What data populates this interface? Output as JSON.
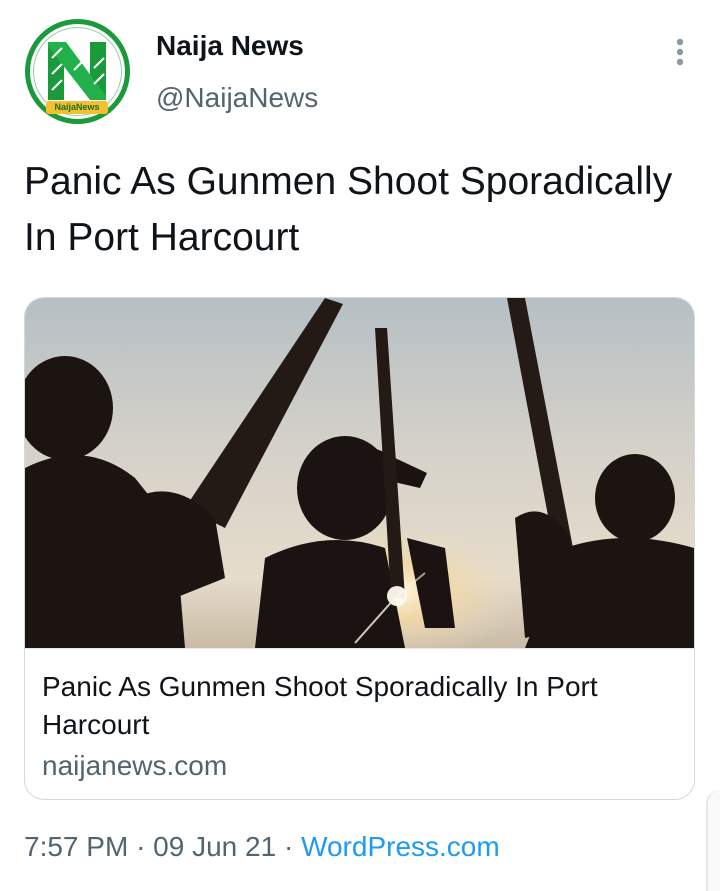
{
  "author": {
    "display_name": "Naija News",
    "handle": "@NaijaNews",
    "avatar_badge": "NaijaNews",
    "logo_letter": "N"
  },
  "tweet": {
    "text": "Panic As Gunmen Shoot Sporadically In Port Harcourt"
  },
  "link_card": {
    "image_icon": "gunmen-silhouette-photo",
    "title": "Panic As Gunmen Shoot Sporadically In Port Harcourt",
    "domain": "naijanews.com"
  },
  "meta": {
    "time": "7:57 PM",
    "separator": "·",
    "date": "09 Jun 21",
    "source": "WordPress.com"
  },
  "icons": {
    "more": "more-vertical-icon"
  },
  "colors": {
    "text": "#0f1419",
    "secondary": "#536471",
    "link": "#1d9bf0",
    "brand_green": "#1b9a3c"
  }
}
